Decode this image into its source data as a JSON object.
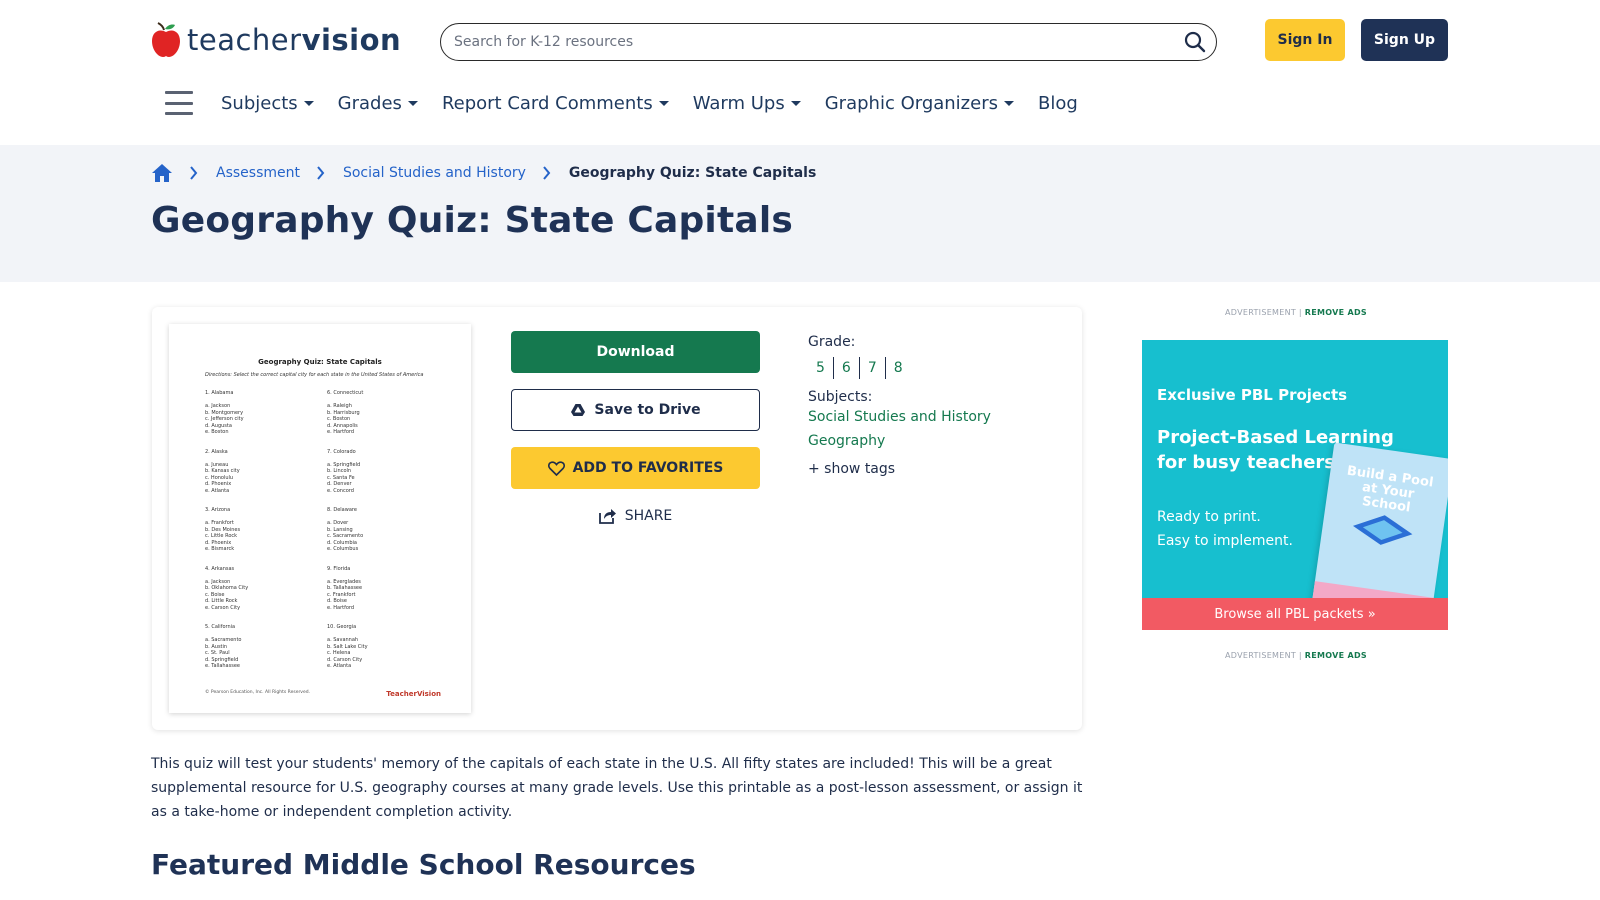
{
  "header": {
    "logo_part1": "teacher",
    "logo_part2": "vision",
    "search_placeholder": "Search for K-12 resources",
    "signin_label": "Sign In",
    "signup_label": "Sign Up"
  },
  "nav": {
    "items": [
      {
        "label": "Subjects",
        "dropdown": true
      },
      {
        "label": "Grades",
        "dropdown": true
      },
      {
        "label": "Report Card Comments",
        "dropdown": true
      },
      {
        "label": "Warm Ups",
        "dropdown": true
      },
      {
        "label": "Graphic Organizers",
        "dropdown": true
      },
      {
        "label": "Blog",
        "dropdown": false
      }
    ]
  },
  "breadcrumb": {
    "items": [
      "Assessment",
      "Social Studies and History"
    ],
    "current": "Geography Quiz: State Capitals"
  },
  "page": {
    "title": "Geography Quiz: State Capitals",
    "description": "This quiz will test your students' memory of the capitals of each state in the U.S. All fifty states are included! This will be a great supplemental resource for U.S. geography courses at many grade levels. Use this printable as a post-lesson assessment, or assign it as a take-home or independent completion activity.",
    "featured_heading": "Featured Middle School Resources"
  },
  "resource": {
    "download_label": "Download",
    "drive_label": "Save to Drive",
    "favorites_label": "ADD TO FAVORITES",
    "share_label": "SHARE",
    "grade_label": "Grade:",
    "grades": [
      "5",
      "6",
      "7",
      "8"
    ],
    "subjects_label": "Subjects:",
    "subjects": [
      "Social Studies and History",
      "Geography"
    ],
    "show_tags_label": "+ show tags"
  },
  "thumbnail": {
    "title": "Geography Quiz: State Capitals",
    "directions": "Directions: Select the correct capital city for each state in the United States of America",
    "left_column": [
      "1. Alabama",
      "",
      "a. Jackson",
      "b. Montgomery",
      "c. Jefferson city",
      "d. Augusta",
      "e. Boston",
      "",
      "",
      "2. Alaska",
      "",
      "a. Juneau",
      "b. Kansas city",
      "c. Honolulu",
      "d. Phoenix",
      "e. Atlanta",
      "",
      "",
      "3. Arizona",
      "",
      "a. Frankfort",
      "b. Des Moines",
      "c. Little Rock",
      "d. Phoenix",
      "e. Bismarck",
      "",
      "",
      "4. Arkansas",
      "",
      "a. Jackson",
      "b. Oklahoma City",
      "c. Boise",
      "d. Little Rock",
      "e. Carson City",
      "",
      "",
      "5. California",
      "",
      "a. Sacramento",
      "b. Austin",
      "c. St. Paul",
      "d. Springfield",
      "e. Tallahassee"
    ],
    "right_column": [
      "6. Connecticut",
      "",
      "a. Raleigh",
      "b. Harrisburg",
      "c. Boston",
      "d. Annapolis",
      "e. Hartford",
      "",
      "",
      "7. Colorado",
      "",
      "a. Springfield",
      "b. Lincoln",
      "c. Santa Fe",
      "d. Denver",
      "e. Concord",
      "",
      "",
      "8. Delaware",
      "",
      "a. Dover",
      "b. Lansing",
      "c. Sacramento",
      "d. Columbia",
      "e. Columbus",
      "",
      "",
      "9. Florida",
      "",
      "a. Everglades",
      "b. Tallahassee",
      "c. Frankfort",
      "d. Boise",
      "e. Hartford",
      "",
      "",
      "10. Georgia",
      "",
      "a. Savannah",
      "b. Salt Lake City",
      "c. Helena",
      "d. Carson City",
      "e. Atlanta"
    ],
    "footer_left": "© Pearson Education, Inc. All Rights Reserved.",
    "footer_right": "TeacherVision"
  },
  "ad": {
    "label": "ADVERTISEMENT |",
    "remove_label": "REMOVE ADS",
    "kicker": "Exclusive PBL Projects",
    "headline": "Project-Based Learning for busy teachers",
    "sub_line1": "Ready to print.",
    "sub_line2": "Easy to implement.",
    "book_title": "Build a Pool at Your School",
    "cta": "Browse all PBL packets »"
  },
  "colors": {
    "brand_navy": "#1f3256",
    "accent_green": "#15794f",
    "accent_yellow": "#fcc930",
    "link_blue": "#2563c9",
    "ad_teal": "#17bfcf",
    "ad_cta_red": "#f25a63"
  }
}
